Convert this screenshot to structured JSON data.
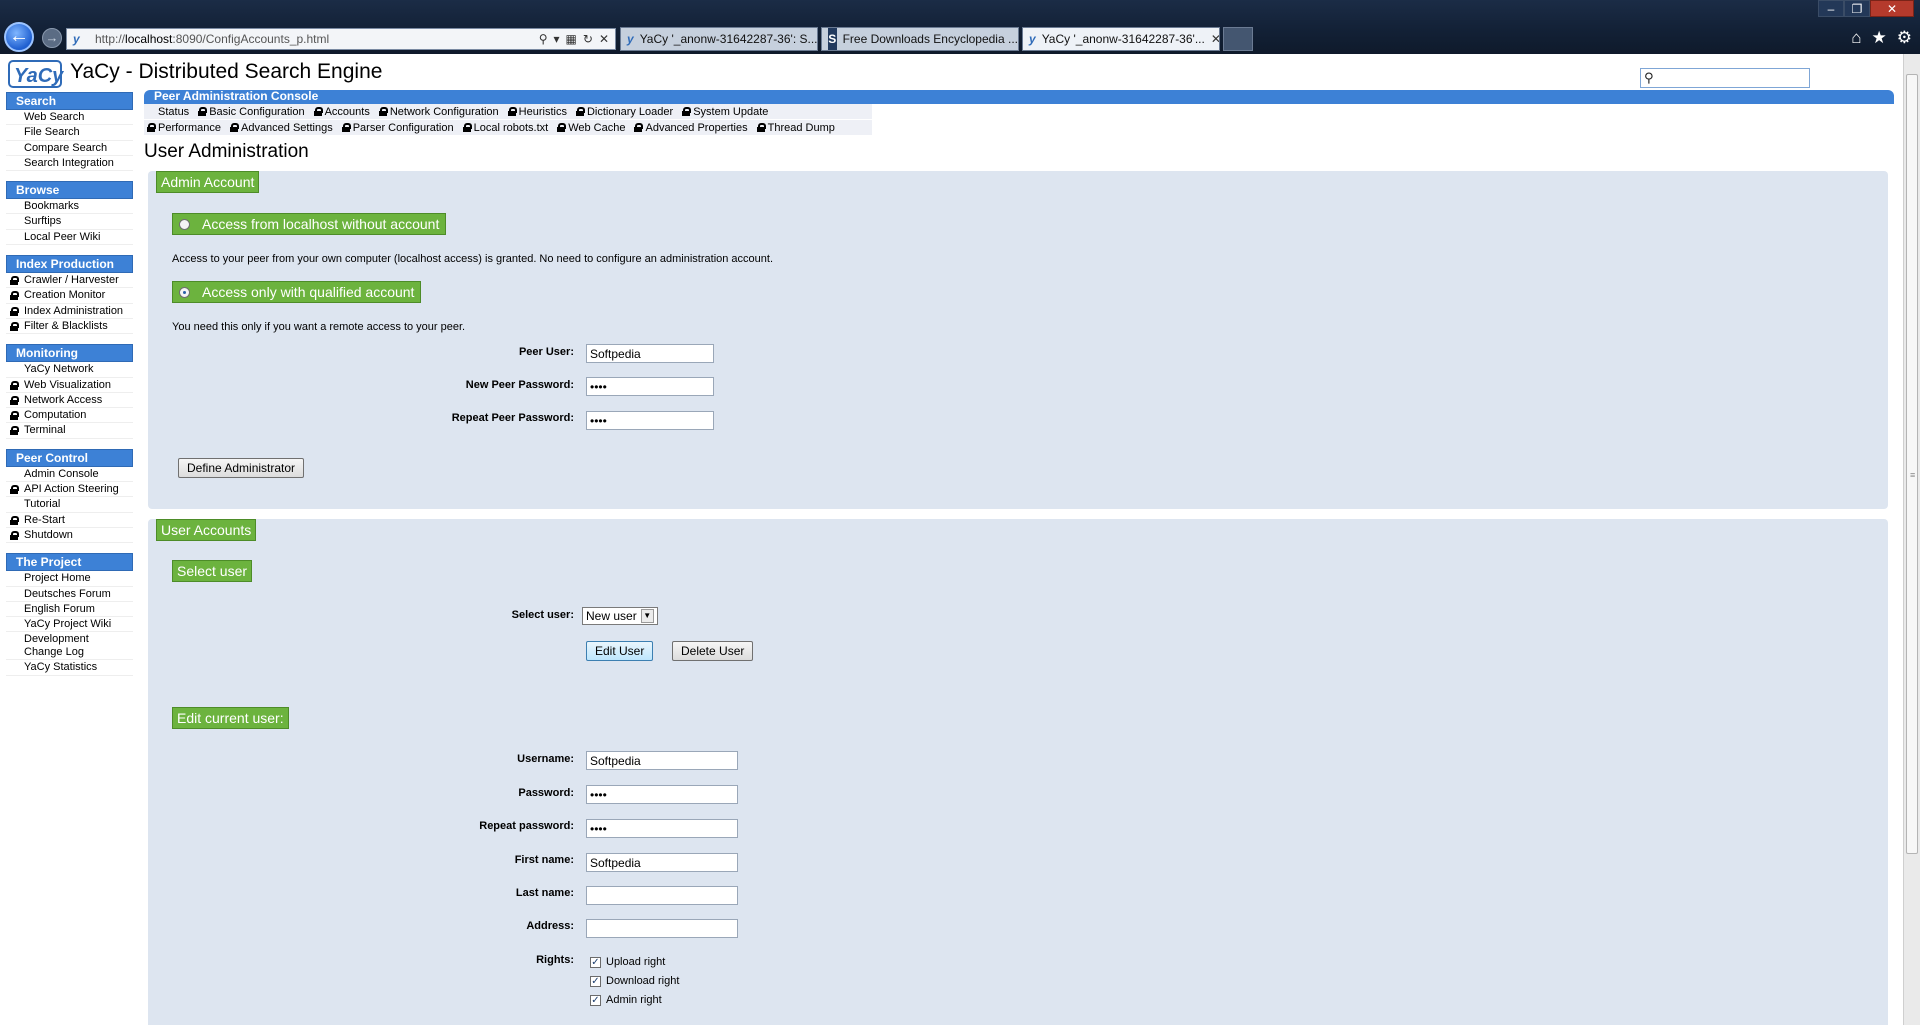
{
  "browser": {
    "url_prefix": "http://",
    "url_host": "localhost",
    "url_rest": ":8090/ConfigAccounts_p.html",
    "tabs": [
      {
        "label": "YaCy '_anonw-31642287-36': S...",
        "icon": "yacy-favicon"
      },
      {
        "label": "Free Downloads Encyclopedia ...",
        "icon": "softpedia-favicon"
      },
      {
        "label": "YaCy '_anonw-31642287-36'...",
        "icon": "yacy-favicon",
        "active": true
      }
    ],
    "colors": {
      "chrome": "#122035",
      "accent": "#3d81d6"
    }
  },
  "header": {
    "title": "YaCy - Distributed Search Engine",
    "logo_text": "YaCy"
  },
  "sidebar": {
    "groups": [
      {
        "title": "Search",
        "items": [
          {
            "label": "Web Search",
            "locked": false
          },
          {
            "label": "File Search",
            "locked": false
          },
          {
            "label": "Compare Search",
            "locked": false
          },
          {
            "label": "Search Integration",
            "locked": false
          }
        ]
      },
      {
        "title": "Browse",
        "items": [
          {
            "label": "Bookmarks",
            "locked": false
          },
          {
            "label": "Surftips",
            "locked": false
          },
          {
            "label": "Local Peer Wiki",
            "locked": false
          }
        ]
      },
      {
        "title": "Index Production",
        "items": [
          {
            "label": "Crawler / Harvester",
            "locked": true
          },
          {
            "label": "Creation Monitor",
            "locked": true
          },
          {
            "label": "Index Administration",
            "locked": true
          },
          {
            "label": "Filter & Blacklists",
            "locked": true
          }
        ]
      },
      {
        "title": "Monitoring",
        "items": [
          {
            "label": "YaCy Network",
            "locked": false
          },
          {
            "label": "Web Visualization",
            "locked": true
          },
          {
            "label": "Network Access",
            "locked": true
          },
          {
            "label": "Computation",
            "locked": true
          },
          {
            "label": "Terminal",
            "locked": true
          }
        ]
      },
      {
        "title": "Peer Control",
        "items": [
          {
            "label": "Admin Console",
            "locked": false
          },
          {
            "label": "API Action Steering",
            "locked": true
          },
          {
            "label": "Tutorial",
            "locked": false
          },
          {
            "label": "Re-Start",
            "locked": true
          },
          {
            "label": "Shutdown",
            "locked": true
          }
        ]
      },
      {
        "title": "The Project",
        "items": [
          {
            "label": "Project Home",
            "locked": false
          },
          {
            "label": "Deutsches Forum",
            "locked": false
          },
          {
            "label": "English Forum",
            "locked": false
          },
          {
            "label": "YaCy Project Wiki",
            "locked": false
          },
          {
            "label": "Development Change Log",
            "locked": false
          },
          {
            "label": "YaCy Statistics",
            "locked": false
          }
        ]
      }
    ]
  },
  "console": {
    "title": "Peer Administration Console",
    "row1": [
      {
        "label": "Status",
        "locked": false
      },
      {
        "label": "Basic Configuration",
        "locked": true
      },
      {
        "label": "Accounts",
        "locked": true
      },
      {
        "label": "Network Configuration",
        "locked": true
      },
      {
        "label": "Heuristics",
        "locked": true
      },
      {
        "label": "Dictionary Loader",
        "locked": true
      },
      {
        "label": "System Update",
        "locked": true
      }
    ],
    "row2": [
      {
        "label": "Performance",
        "locked": true
      },
      {
        "label": "Advanced Settings",
        "locked": true
      },
      {
        "label": "Parser Configuration",
        "locked": true
      },
      {
        "label": "Local robots.txt",
        "locked": true
      },
      {
        "label": "Web Cache",
        "locked": true
      },
      {
        "label": "Advanced Properties",
        "locked": true
      },
      {
        "label": "Thread Dump",
        "locked": true
      }
    ]
  },
  "main": {
    "page_title": "User Administration",
    "admin": {
      "legend": "Admin Account",
      "option_localhost": "Access from localhost without account",
      "option_localhost_note": "Access to your peer from your own computer (localhost access) is granted. No need to configure an administration account.",
      "option_qualified": "Access only with qualified account",
      "option_qualified_note": "You need this only if you want a remote access to your peer.",
      "peer_user_label": "Peer User:",
      "peer_user_value": "Softpedia",
      "new_pw_label": "New Peer Password:",
      "new_pw_value": "****",
      "repeat_pw_label": "Repeat Peer Password:",
      "repeat_pw_value": "****",
      "define_button": "Define Administrator"
    },
    "users": {
      "legend": "User Accounts",
      "select_legend": "Select user",
      "select_label": "Select user:",
      "select_value": "New user",
      "edit_button": "Edit User",
      "delete_button": "Delete User",
      "edit_legend": "Edit current user:",
      "username_label": "Username:",
      "username_value": "Softpedia",
      "password_label": "Password:",
      "password_value": "****",
      "repeat_label": "Repeat password:",
      "repeat_value": "****",
      "firstname_label": "First name:",
      "firstname_value": "Softpedia",
      "lastname_label": "Last name:",
      "lastname_value": "",
      "address_label": "Address:",
      "address_value": "",
      "rights_label": "Rights:",
      "rights": [
        {
          "label": "Upload right",
          "checked": true
        },
        {
          "label": "Download right",
          "checked": true
        },
        {
          "label": "Admin right",
          "checked": true
        }
      ]
    }
  }
}
